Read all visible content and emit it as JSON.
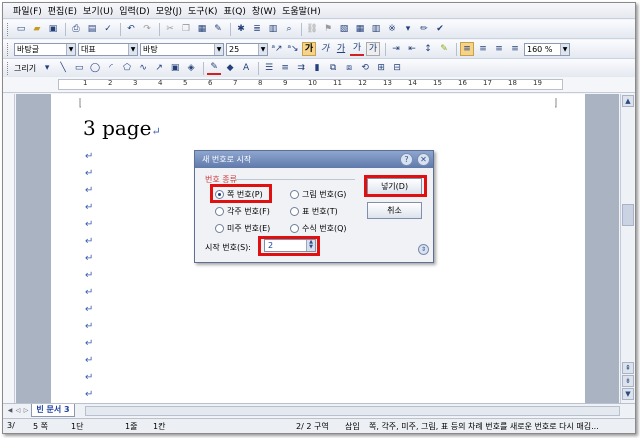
{
  "menu": [
    "파일(F)",
    "편집(E)",
    "보기(U)",
    "입력(D)",
    "모양(J)",
    "도구(K)",
    "표(Q)",
    "창(W)",
    "도움말(H)"
  ],
  "toolbar2": {
    "style_combo": "바탕글",
    "shape_combo": "대표",
    "font_combo": "바탕",
    "size_combo": "25",
    "bold": "가",
    "italic": "가",
    "underline": "가",
    "font_color": "가",
    "highlight": "가",
    "zoom": "160 %"
  },
  "toolbar3": {
    "draw_label": "그리기"
  },
  "ruler": {
    "numbers": [
      "1",
      "2",
      "3",
      "4",
      "5",
      "6",
      "7",
      "8",
      "9",
      "10",
      "11",
      "12",
      "13",
      "14",
      "15",
      "16",
      "17",
      "18",
      "19"
    ]
  },
  "document": {
    "title_text": "3 page",
    "para_mark": "↵"
  },
  "dialog": {
    "title": "새 번호로 시작",
    "help_btn": "?",
    "close_btn": "✕",
    "group_label": "번호 종류",
    "radios": [
      "쪽 번호(P)",
      "그림 번호(G)",
      "각주 번호(F)",
      "표 번호(T)",
      "미주 번호(E)",
      "수식 번호(Q)"
    ],
    "start_label": "시작 번호(S):",
    "start_value": "2",
    "insert_btn": "넣기(D)",
    "cancel_btn": "취소"
  },
  "tabbar": {
    "doc_tab": "빈 문서 3"
  },
  "status": {
    "page": "3/",
    "pageno": "5 쪽",
    "column": "1단",
    "line": "1줄",
    "col": "1칸",
    "section": "2/ 2 구역",
    "mode": "삽입",
    "help": "쪽, 각주, 미주, 그림, 표 등의 차례 번호를 새로운 번호로 다시 매김..."
  },
  "colors": {
    "highlight_box": "#e01010",
    "title_bar": "#6b84b5",
    "para_mark": "#3b5fb0"
  }
}
